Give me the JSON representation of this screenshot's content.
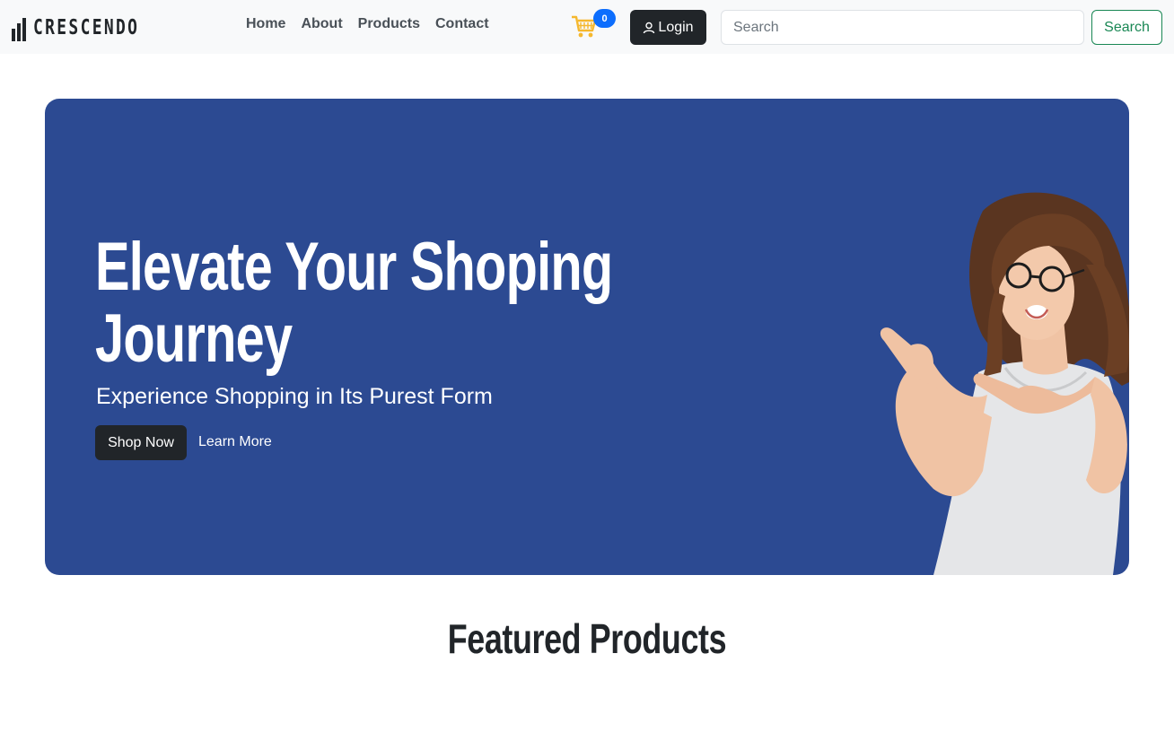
{
  "brand": {
    "name": "CRESCENDO"
  },
  "nav": {
    "links": [
      {
        "label": "Home"
      },
      {
        "label": "About"
      },
      {
        "label": "Products"
      },
      {
        "label": "Contact"
      }
    ],
    "cart": {
      "icon": "shopping-cart-icon",
      "count": "0"
    },
    "login": {
      "icon": "user-icon",
      "label": "Login"
    },
    "search": {
      "placeholder": "Search",
      "value": "",
      "button_label": "Search"
    }
  },
  "hero": {
    "title": "Elevate Your Shoping Journey",
    "subtitle": "Experience Shopping in Its Purest Form",
    "primary_button": "Shop Now",
    "secondary_link": "Learn More"
  },
  "featured": {
    "title": "Featured Products"
  },
  "colors": {
    "navbar_bg": "#f8f9fa",
    "hero_bg": "#2c4a92",
    "dark_button": "#212529",
    "badge": "#0d6efd",
    "search_button": "#198754",
    "cart_icon": "#f5b82e"
  }
}
